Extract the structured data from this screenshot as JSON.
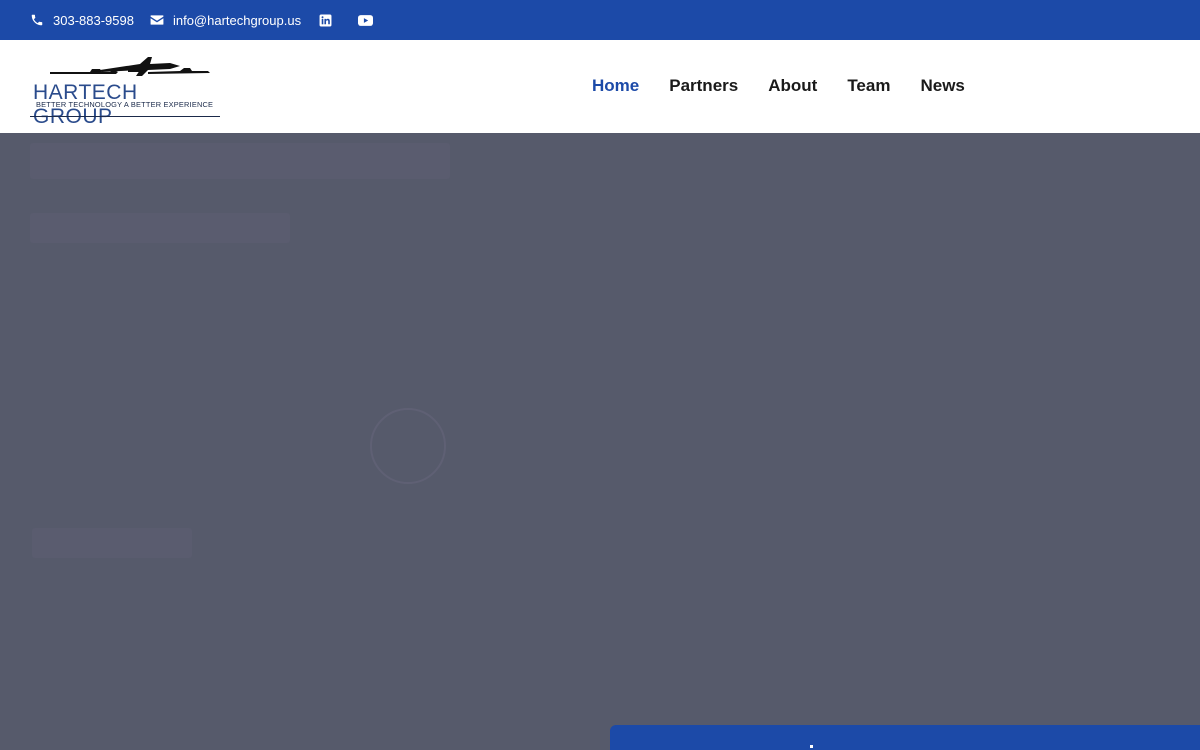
{
  "topbar": {
    "phone": "303-883-9598",
    "email": "info@hartechgroup.us",
    "social": [
      "linkedin-icon",
      "youtube-icon"
    ]
  },
  "header": {
    "logo": {
      "brand": "HARTECH GROUP",
      "tagline": "BETTER TECHNOLOGY A BETTER EXPERIENCE"
    },
    "nav": [
      {
        "label": "Home",
        "active": true
      },
      {
        "label": "Partners",
        "active": false
      },
      {
        "label": "About",
        "active": false
      },
      {
        "label": "Team",
        "active": false
      },
      {
        "label": "News",
        "active": false
      }
    ]
  },
  "colors": {
    "primary": "#1c4aa8",
    "overlay": "#565a6b",
    "header_bg": "#ffffff"
  }
}
